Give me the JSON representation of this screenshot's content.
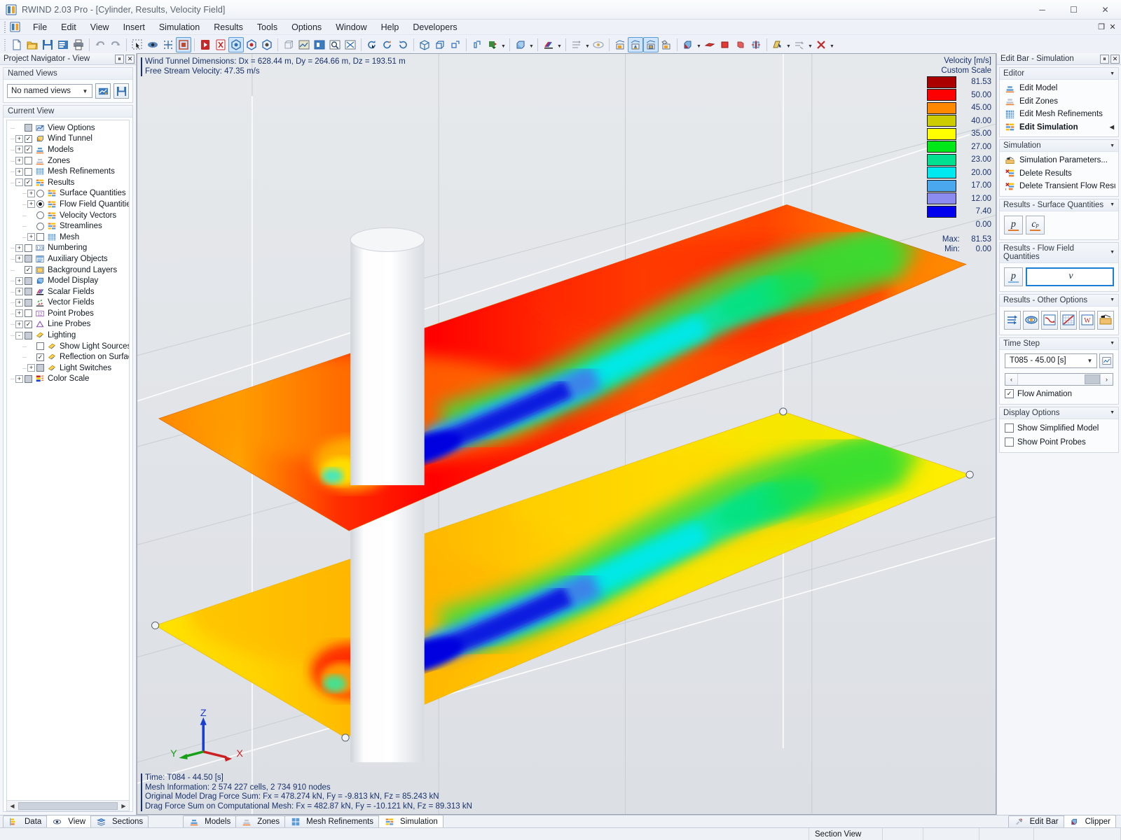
{
  "window": {
    "title": "RWIND 2.03 Pro - [Cylinder, Results, Velocity Field]",
    "minimize": "─",
    "maximize": "☐",
    "close": "✕"
  },
  "menu": {
    "items": [
      {
        "label": "File"
      },
      {
        "label": "Edit"
      },
      {
        "label": "View"
      },
      {
        "label": "Insert"
      },
      {
        "label": "Simulation"
      },
      {
        "label": "Results"
      },
      {
        "label": "Tools"
      },
      {
        "label": "Options"
      },
      {
        "label": "Window"
      },
      {
        "label": "Help"
      },
      {
        "label": "Developers"
      }
    ],
    "restore_down": "❐",
    "close_doc": "✕"
  },
  "navigator": {
    "title": "Project Navigator - View",
    "pin": "⏸",
    "close": "✕",
    "named_views": {
      "header": "Named Views",
      "selected": "No named views",
      "arrow": "▼"
    },
    "current_view": {
      "header": "Current View"
    },
    "tree": [
      {
        "label": "View Options",
        "indent": 0,
        "toggle": "",
        "box": "gray-filled",
        "icon": "view-options-icon"
      },
      {
        "label": "Wind Tunnel",
        "indent": 0,
        "toggle": "+",
        "box": "checked",
        "icon": "wind-tunnel-icon"
      },
      {
        "label": "Models",
        "indent": 0,
        "toggle": "+",
        "box": "checked",
        "icon": "model-icon"
      },
      {
        "label": "Zones",
        "indent": 0,
        "toggle": "+",
        "box": "unchecked",
        "icon": "zones-icon"
      },
      {
        "label": "Mesh Refinements",
        "indent": 0,
        "toggle": "+",
        "box": "unchecked",
        "icon": "mesh-refinements-icon"
      },
      {
        "label": "Results",
        "indent": 0,
        "toggle": "-",
        "box": "checked",
        "icon": "results-icon"
      },
      {
        "label": "Surface Quantities",
        "indent": 1,
        "toggle": "+",
        "box": "radio",
        "icon": "results-icon"
      },
      {
        "label": "Flow Field Quantities",
        "indent": 1,
        "toggle": "+",
        "box": "radio-on",
        "icon": "results-icon"
      },
      {
        "label": "Velocity Vectors",
        "indent": 1,
        "toggle": "",
        "box": "radio",
        "icon": "results-icon"
      },
      {
        "label": "Streamlines",
        "indent": 1,
        "toggle": "",
        "box": "radio",
        "icon": "results-icon"
      },
      {
        "label": "Mesh",
        "indent": 1,
        "toggle": "+",
        "box": "unchecked",
        "icon": "mesh-refinements-icon"
      },
      {
        "label": "Numbering",
        "indent": 0,
        "toggle": "+",
        "box": "unchecked",
        "icon": "numbering-icon"
      },
      {
        "label": "Auxiliary Objects",
        "indent": 0,
        "toggle": "+",
        "box": "gray-filled",
        "icon": "aux-objects-icon"
      },
      {
        "label": "Background Layers",
        "indent": 0,
        "toggle": "",
        "box": "checked",
        "icon": "background-layers-icon"
      },
      {
        "label": "Model Display",
        "indent": 0,
        "toggle": "+",
        "box": "gray-filled",
        "icon": "model-display-icon"
      },
      {
        "label": "Scalar Fields",
        "indent": 0,
        "toggle": "+",
        "box": "gray-filled",
        "icon": "scalar-fields-icon"
      },
      {
        "label": "Vector Fields",
        "indent": 0,
        "toggle": "+",
        "box": "gray-filled",
        "icon": "vector-fields-icon"
      },
      {
        "label": "Point Probes",
        "indent": 0,
        "toggle": "+",
        "box": "unchecked",
        "icon": "point-probes-icon"
      },
      {
        "label": "Line Probes",
        "indent": 0,
        "toggle": "+",
        "box": "checked",
        "icon": "line-probes-icon"
      },
      {
        "label": "Lighting",
        "indent": 0,
        "toggle": "-",
        "box": "gray-filled",
        "icon": "lighting-icon"
      },
      {
        "label": "Show Light Sources",
        "indent": 1,
        "toggle": "",
        "box": "unchecked",
        "icon": "lighting-icon"
      },
      {
        "label": "Reflection on Surface",
        "indent": 1,
        "toggle": "",
        "box": "checked",
        "icon": "lighting-icon"
      },
      {
        "label": "Light Switches",
        "indent": 1,
        "toggle": "+",
        "box": "gray-filled",
        "icon": "lighting-icon"
      },
      {
        "label": "Color Scale",
        "indent": 0,
        "toggle": "+",
        "box": "gray-filled",
        "icon": "color-scale-icon"
      }
    ]
  },
  "viewport": {
    "info_top": [
      "Wind Tunnel Dimensions: Dx = 628.44 m, Dy = 264.66 m, Dz = 193.51 m",
      "Free Stream Velocity: 47.35 m/s"
    ],
    "info_bottom": [
      "Time: T084 - 44.50 [s]",
      "Mesh Information: 2 574 227 cells, 2 734 910 nodes",
      "Original Model Drag Force Sum: Fx = 478.274 kN, Fy = -9.813 kN, Fz = 85.243 kN",
      "Drag Force Sum on Computational Mesh: Fx = 482.87 kN, Fy = -10.121 kN, Fz = 89.313 kN"
    ],
    "axes": {
      "x": "X",
      "y": "Y",
      "z": "Z"
    }
  },
  "legend": {
    "title": "Velocity [m/s]",
    "subtitle": "Custom Scale",
    "entries": [
      {
        "color": "#aa0000",
        "value": "81.53"
      },
      {
        "color": "#ff0000",
        "value": "50.00"
      },
      {
        "color": "#ff8800",
        "value": "45.00"
      },
      {
        "color": "#cccc00",
        "value": "40.00"
      },
      {
        "color": "#ffff00",
        "value": "35.00"
      },
      {
        "color": "#00e817",
        "value": "27.00"
      },
      {
        "color": "#00e090",
        "value": "23.00"
      },
      {
        "color": "#00e8f0",
        "value": "20.00"
      },
      {
        "color": "#4aa8ee",
        "value": "17.00"
      },
      {
        "color": "#8c8cf0",
        "value": "12.00"
      },
      {
        "color": "#0000ee",
        "value": "7.40"
      },
      {
        "color": "",
        "value": "0.00"
      }
    ],
    "max_label": "Max:",
    "max_value": "81.53",
    "min_label": "Min:",
    "min_value": "0.00"
  },
  "editbar": {
    "title": "Edit Bar - Simulation",
    "pin": "⏸",
    "close": "✕",
    "chevron": "▼",
    "sections": [
      {
        "header": "Editor",
        "items": [
          {
            "label": "Edit Model",
            "icon": "model-icon",
            "bold": false,
            "chevron": ""
          },
          {
            "label": "Edit Zones",
            "icon": "zones-icon",
            "bold": false,
            "chevron": ""
          },
          {
            "label": "Edit Mesh Refinements",
            "icon": "mesh-refinements-icon",
            "bold": false,
            "chevron": ""
          },
          {
            "label": "Edit Simulation",
            "icon": "results-icon",
            "bold": true,
            "chevron": "◀"
          }
        ]
      },
      {
        "header": "Simulation",
        "items": [
          {
            "label": "Simulation Parameters...",
            "icon": "sim-params-icon",
            "bold": false,
            "chevron": ""
          },
          {
            "label": "Delete Results",
            "icon": "delete-results-icon",
            "bold": false,
            "chevron": ""
          },
          {
            "label": "Delete Transient Flow Result...",
            "icon": "delete-transient-icon",
            "bold": false,
            "chevron": ""
          }
        ]
      }
    ],
    "surface_quantities": {
      "header": "Results - Surface Quantities",
      "buttons": [
        {
          "name": "pressure-button",
          "label": "p",
          "sub": "",
          "selected": false
        },
        {
          "name": "cp-button",
          "label": "c",
          "sub": "p",
          "selected": false
        }
      ]
    },
    "flow_field_quantities": {
      "header": "Results - Flow Field Quantities",
      "buttons": [
        {
          "name": "flow-pressure-button",
          "label": "p",
          "sub": "",
          "selected": false
        },
        {
          "name": "flow-velocity-button",
          "label": "v",
          "sub": "",
          "selected": true
        }
      ]
    },
    "other_options": {
      "header": "Results - Other Options",
      "buttons": [
        {
          "name": "velocity-vectors-button"
        },
        {
          "name": "streamlines-button"
        },
        {
          "name": "result-diagram-button"
        },
        {
          "name": "convergence-chart-button"
        },
        {
          "name": "export-word-button"
        },
        {
          "name": "result-settings-button"
        }
      ]
    },
    "time_step": {
      "header": "Time Step",
      "selected": "T085 - 45.00 [s]",
      "arrow": "▼",
      "prev": "‹",
      "next": "›",
      "animation_label": "Flow Animation",
      "animation_checked": true
    },
    "display_options": {
      "header": "Display Options",
      "options": [
        {
          "label": "Show Simplified Model",
          "checked": false
        },
        {
          "label": "Show Point Probes",
          "checked": false
        }
      ]
    }
  },
  "bottom_tabs": {
    "left": [
      {
        "label": "Data",
        "icon": "data-icon",
        "active": false
      },
      {
        "label": "View",
        "icon": "eye-icon",
        "active": true
      },
      {
        "label": "Sections",
        "icon": "sections-icon",
        "active": false
      }
    ],
    "middle": [
      {
        "label": "Models",
        "icon": "model-icon",
        "active": false
      },
      {
        "label": "Zones",
        "icon": "zones-icon",
        "active": false
      },
      {
        "label": "Mesh Refinements",
        "icon": "mesh-refinements-icon",
        "active": false
      },
      {
        "label": "Simulation",
        "icon": "results-icon",
        "active": true
      }
    ],
    "right": [
      {
        "label": "Edit Bar",
        "icon": "tools-icon",
        "active": false
      },
      {
        "label": "Clipper",
        "icon": "clipper-icon",
        "active": true
      }
    ]
  },
  "statusbar": {
    "cells": [
      "",
      "Section View",
      "",
      "",
      "",
      ""
    ]
  },
  "colors": {
    "accent": "#1a7fd4",
    "info_text": "#18316e",
    "panel_bg": "#f5f6f9"
  }
}
